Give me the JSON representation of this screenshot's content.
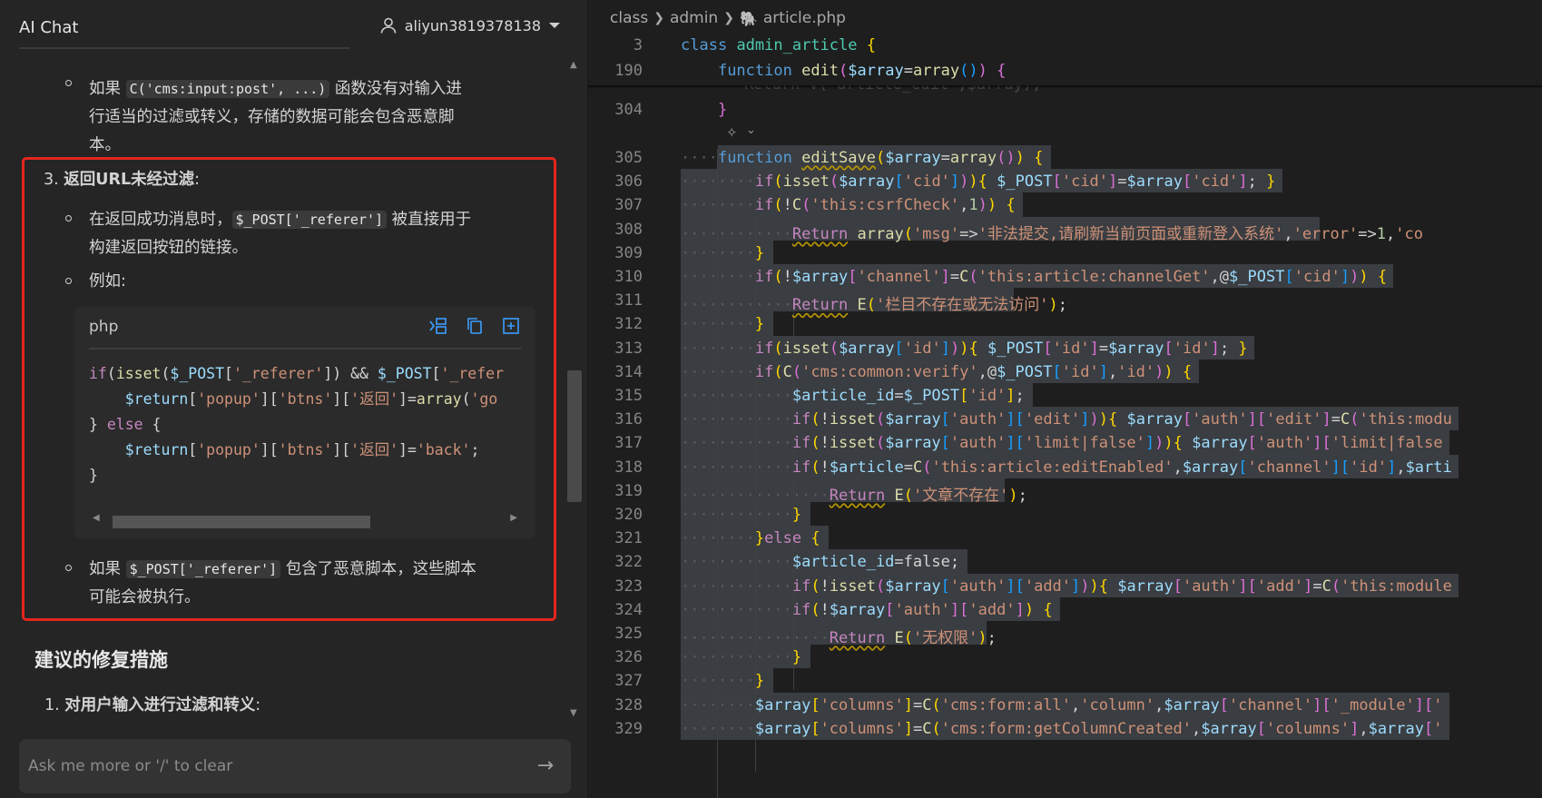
{
  "chat": {
    "title": "AI Chat",
    "user": "aliyun3819378138",
    "para1_prefix": "如果",
    "para1_code": "C('cms:input:post', ...)",
    "para1_suffix_line1": "函数没有对输入进",
    "para1_line2": "行适当的过滤或转义，存储的数据可能会包含恶意脚",
    "para1_line3": "本。",
    "item3_num": "3.",
    "item3_title": "返回URL未经过滤",
    "item3_colon": ":",
    "sub1_prefix": "在返回成功消息时，",
    "sub1_code": "$_POST['_referer']",
    "sub1_suffix": "被直接用于",
    "sub1_line2": "构建返回按钮的链接。",
    "sub2": "例如:",
    "code_lang": "php",
    "code_lines": [
      "if(isset($_POST['_referer']) && $_POST['_refer",
      "    $return['popup']['btns']['返回']=array('go",
      "} else {",
      "    $return['popup']['btns']['返回']='back';",
      "}"
    ],
    "sub3_prefix": "如果",
    "sub3_code": "$_POST['_referer']",
    "sub3_suffix": "包含了恶意脚本，这些脚本",
    "sub3_line2": "可能会被执行。",
    "section_heading": "建议的修复措施",
    "footer_item_num": "1.",
    "footer_item_title": "对用户输入进行过滤和转义",
    "footer_item_colon": ":",
    "input_placeholder": "Ask me more or '/' to clear"
  },
  "editor": {
    "breadcrumb": [
      "class",
      "admin",
      "article.php"
    ],
    "icons": [
      "chevron-right-icon",
      "php-elephant-icon",
      "sparkle-icon",
      "chevron-down-icon"
    ],
    "sticky": [
      {
        "ln": "3",
        "text": "class admin_article {"
      },
      {
        "ln": "190",
        "text": "    function edit($array=array()) {"
      }
    ],
    "lines": [
      {
        "ln": "304",
        "text": "    }"
      },
      {
        "ln": "305",
        "text": "    function editSave($array=array()) {"
      },
      {
        "ln": "306",
        "text": "        if(isset($array['cid'])){ $_POST['cid']=$array['cid']; }"
      },
      {
        "ln": "307",
        "text": "        if(!C('this:csrfCheck',1)) {"
      },
      {
        "ln": "308",
        "text": "            Return array('msg'=>'非法提交,请刷新当前页面或重新登入系统','error'=>1,'co"
      },
      {
        "ln": "309",
        "text": "        }"
      },
      {
        "ln": "310",
        "text": "        if(!$array['channel']=C('this:article:channelGet',@$_POST['cid'])) {"
      },
      {
        "ln": "311",
        "text": "            Return E('栏目不存在或无法访问');"
      },
      {
        "ln": "312",
        "text": "        }"
      },
      {
        "ln": "313",
        "text": "        if(isset($array['id'])){ $_POST['id']=$array['id']; }"
      },
      {
        "ln": "314",
        "text": "        if(C('cms:common:verify',@$_POST['id'],'id')) {"
      },
      {
        "ln": "315",
        "text": "            $article_id=$_POST['id'];"
      },
      {
        "ln": "316",
        "text": "            if(!isset($array['auth']['edit'])){ $array['auth']['edit']=C('this:modu"
      },
      {
        "ln": "317",
        "text": "            if(!isset($array['auth']['limit|false'])){ $array['auth']['limit|false"
      },
      {
        "ln": "318",
        "text": "            if(!$article=C('this:article:editEnabled',$array['channel']['id'],$arti"
      },
      {
        "ln": "319",
        "text": "                Return E('文章不存在');"
      },
      {
        "ln": "320",
        "text": "            }"
      },
      {
        "ln": "321",
        "text": "        }else {"
      },
      {
        "ln": "322",
        "text": "            $article_id=false;"
      },
      {
        "ln": "323",
        "text": "            if(!isset($array['auth']['add'])){ $array['auth']['add']=C('this:module"
      },
      {
        "ln": "324",
        "text": "            if(!$array['auth']['add']) {"
      },
      {
        "ln": "325",
        "text": "                Return E('无权限');"
      },
      {
        "ln": "326",
        "text": "            }"
      },
      {
        "ln": "327",
        "text": "        }"
      },
      {
        "ln": "328",
        "text": "        $array['columns']=C('cms:form:all','column',$array['channel']['_module']['"
      },
      {
        "ln": "329",
        "text": "        $array['columns']=C('cms:form:getColumnCreated',$array['columns'],$array['"
      }
    ],
    "ghost_line": "        Return V('article_edit',$array);"
  },
  "colors": {
    "highlight_border": "#e3261c",
    "selection": "#3a3d41",
    "accent": "#569cd6"
  }
}
